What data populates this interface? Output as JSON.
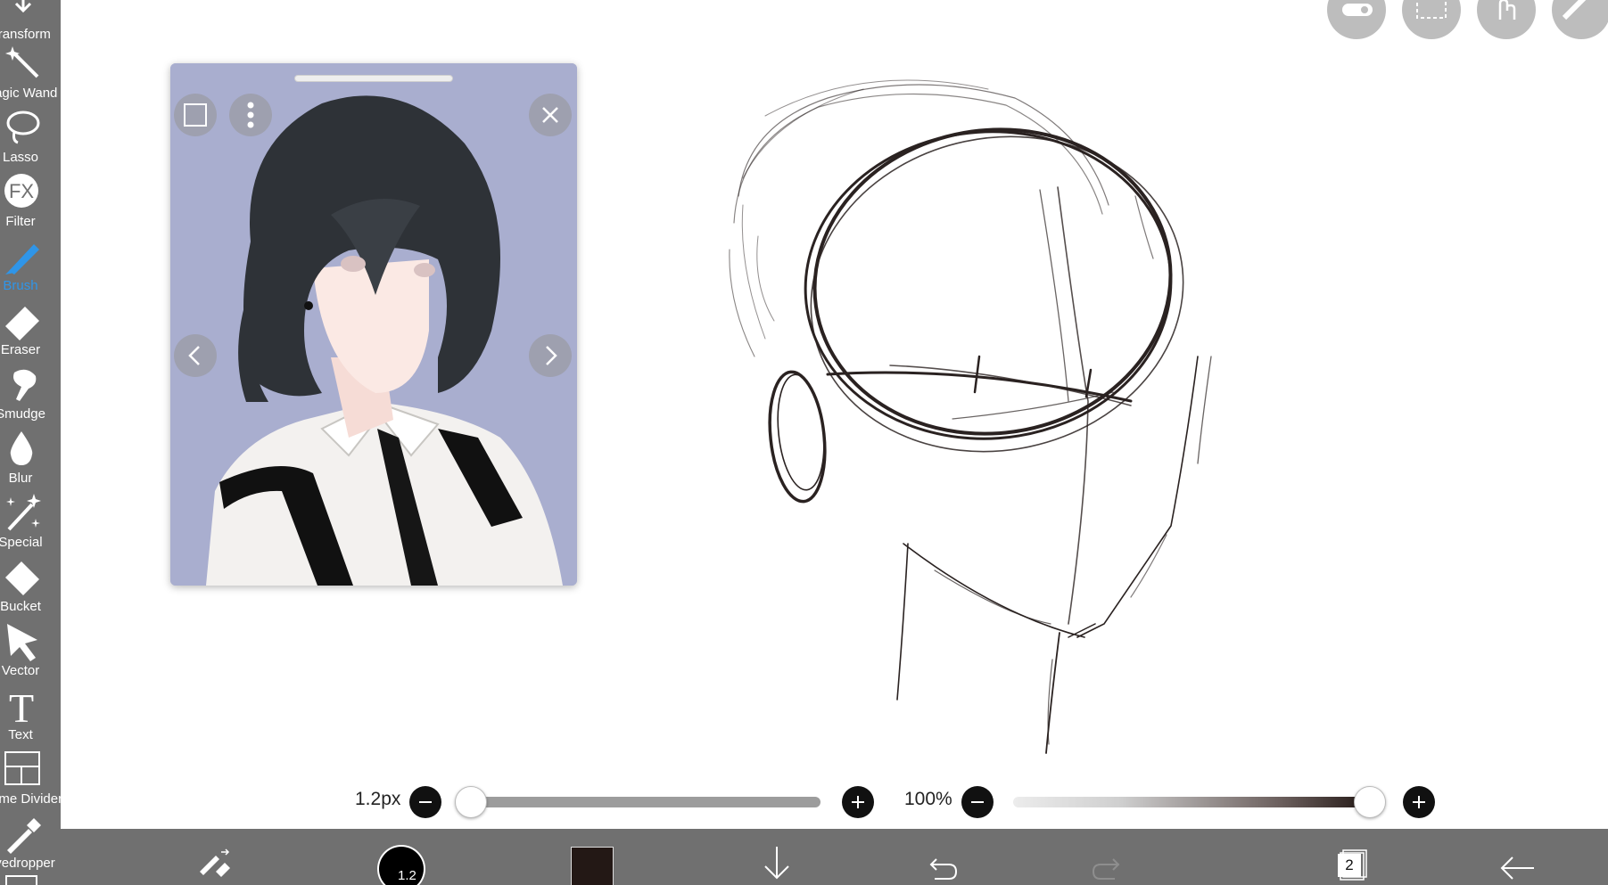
{
  "sidebar": {
    "items": [
      {
        "label": "Transform",
        "icon": "transform-icon"
      },
      {
        "label": "Magic Wand",
        "icon": "magic-wand-icon"
      },
      {
        "label": "Lasso",
        "icon": "lasso-icon"
      },
      {
        "label": "Filter",
        "icon": "fx-icon",
        "icon_text": "FX"
      },
      {
        "label": "Brush",
        "icon": "brush-icon",
        "active": true
      },
      {
        "label": "Eraser",
        "icon": "eraser-icon"
      },
      {
        "label": "Smudge",
        "icon": "smudge-icon"
      },
      {
        "label": "Blur",
        "icon": "blur-drop-icon"
      },
      {
        "label": "Special",
        "icon": "special-sparkle-icon"
      },
      {
        "label": "Bucket",
        "icon": "bucket-icon"
      },
      {
        "label": "Vector",
        "icon": "vector-arrow-icon"
      },
      {
        "label": "Text",
        "icon": "text-icon",
        "icon_text": "T"
      },
      {
        "label": "Frame Divider",
        "icon": "frame-divider-icon"
      },
      {
        "label": "Eyedropper",
        "icon": "eyedropper-icon"
      }
    ],
    "active_color": "#2f95e8"
  },
  "top_buttons": [
    {
      "name": "toggle-icon"
    },
    {
      "name": "selection-icon"
    },
    {
      "name": "hand-gesture-icon"
    },
    {
      "name": "ruler-icon"
    }
  ],
  "reference_window": {
    "background_color": "#a9aecf"
  },
  "brush_size": {
    "value_label": "1.2px",
    "fraction": 0.02
  },
  "opacity": {
    "value_label": "100%",
    "fraction": 1.0
  },
  "bottom_bar": {
    "brush_size_label": "1.2",
    "current_color": "#231815",
    "layer_count": "2"
  }
}
